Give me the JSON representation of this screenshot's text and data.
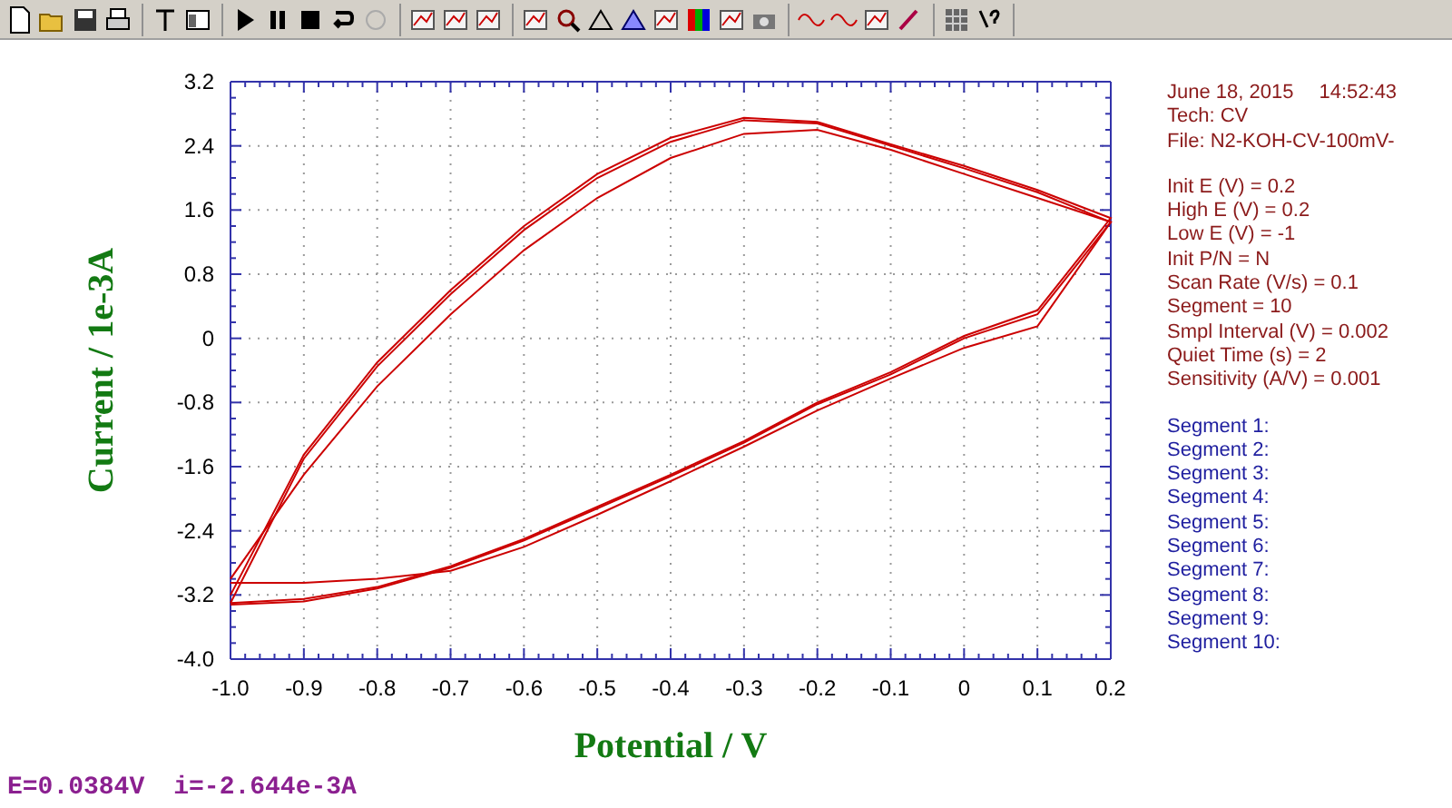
{
  "info": {
    "date": "June 18, 2015",
    "time": "14:52:43",
    "lines": [
      "Tech: CV",
      "File: N2-KOH-CV-100mV-",
      "Init E (V) = 0.2",
      "High E (V) = 0.2",
      "Low E (V) = -1",
      "Init P/N = N",
      "Scan Rate (V/s) = 0.1",
      "Segment = 10",
      "Smpl Interval (V) = 0.002",
      "Quiet Time (s) = 2",
      "Sensitivity (A/V) = 0.001"
    ]
  },
  "segments": [
    "Segment 1:",
    "Segment 2:",
    "Segment 3:",
    "Segment 4:",
    "Segment 5:",
    "Segment 6:",
    "Segment 7:",
    "Segment 8:",
    "Segment 9:",
    "Segment 10:"
  ],
  "chart_data": {
    "type": "line",
    "xlabel": "Potential / V",
    "ylabel": "Current / 1e-3A",
    "x": [
      -1.0,
      -0.9,
      -0.8,
      -0.7,
      -0.6,
      -0.5,
      -0.4,
      -0.3,
      -0.2,
      -0.1,
      0.0,
      0.1,
      0.2,
      0.1,
      0.0,
      -0.1,
      -0.2,
      -0.3,
      -0.4,
      -0.5,
      -0.6,
      -0.7,
      -0.8,
      -0.9,
      -1.0
    ],
    "series": [
      {
        "color": "#cc0000",
        "values": [
          -3.2,
          -1.45,
          -0.3,
          0.6,
          1.4,
          2.05,
          2.5,
          2.75,
          2.7,
          2.42,
          2.15,
          1.85,
          1.5,
          0.35,
          0.03,
          -0.42,
          -0.8,
          -1.28,
          -1.7,
          -2.1,
          -2.5,
          -2.84,
          -3.1,
          -3.25,
          -3.3
        ]
      },
      {
        "color": "#cc0000",
        "values": [
          -3.3,
          -1.5,
          -0.35,
          0.55,
          1.35,
          2.0,
          2.45,
          2.72,
          2.68,
          2.4,
          2.12,
          1.82,
          1.45,
          0.3,
          0.0,
          -0.45,
          -0.82,
          -1.3,
          -1.72,
          -2.12,
          -2.52,
          -2.86,
          -3.12,
          -3.28,
          -3.32
        ]
      },
      {
        "color": "#cc0000",
        "values": [
          -3.0,
          -1.7,
          -0.6,
          0.3,
          1.1,
          1.75,
          2.25,
          2.55,
          2.6,
          2.35,
          2.05,
          1.75,
          1.45,
          0.15,
          -0.12,
          -0.5,
          -0.9,
          -1.35,
          -1.78,
          -2.2,
          -2.6,
          -2.9,
          -3.0,
          -3.05,
          -3.05
        ]
      }
    ],
    "grid": true,
    "xlim": [
      -1.0,
      0.2
    ],
    "ylim": [
      -4.0,
      3.2
    ],
    "xticks": [
      {
        "value": -1.0,
        "label": "-1.0"
      },
      {
        "value": -0.9,
        "label": "-0.9"
      },
      {
        "value": -0.8,
        "label": "-0.8"
      },
      {
        "value": -0.7,
        "label": "-0.7"
      },
      {
        "value": -0.6,
        "label": "-0.6"
      },
      {
        "value": -0.5,
        "label": "-0.5"
      },
      {
        "value": -0.4,
        "label": "-0.4"
      },
      {
        "value": -0.3,
        "label": "-0.3"
      },
      {
        "value": -0.2,
        "label": "-0.2"
      },
      {
        "value": -0.1,
        "label": "-0.1"
      },
      {
        "value": 0,
        "label": "0"
      },
      {
        "value": 0.1,
        "label": "0.1"
      },
      {
        "value": 0.2,
        "label": "0.2"
      }
    ],
    "yticks": [
      {
        "value": 3.2,
        "label": "3.2"
      },
      {
        "value": 2.4,
        "label": "2.4"
      },
      {
        "value": 1.6,
        "label": "1.6"
      },
      {
        "value": 0.8,
        "label": "0.8"
      },
      {
        "value": 0,
        "label": "0"
      },
      {
        "value": -0.8,
        "label": "-0.8"
      },
      {
        "value": -1.6,
        "label": "-1.6"
      },
      {
        "value": -2.4,
        "label": "-2.4"
      },
      {
        "value": -3.2,
        "label": "-3.2"
      },
      {
        "value": -4.0,
        "label": "-4.0"
      }
    ]
  },
  "status": {
    "potential": "E=0.0384V",
    "current": "i=-2.644e-3A"
  }
}
